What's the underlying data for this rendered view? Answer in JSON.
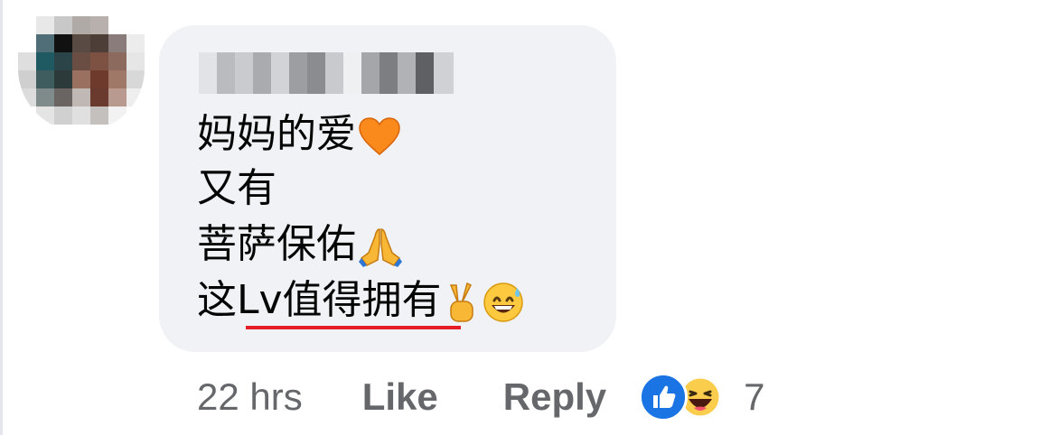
{
  "comment": {
    "author_name_label": "Comment author name (blurred)",
    "lines": [
      "妈妈的爱",
      "又有",
      "菩萨保佑",
      "这",
      "Lv值得拥有"
    ],
    "emoji": {
      "line1": "orange-heart",
      "line3": "folded-hands",
      "line4": [
        "victory-hand",
        "grinning-sweat-face"
      ]
    },
    "highlight_color": "#e41e26"
  },
  "actions": {
    "time": "22 hrs",
    "like_label": "Like",
    "reply_label": "Reply",
    "reaction_count": "7",
    "reactions": [
      "like",
      "haha"
    ],
    "like_color": "#1b74e4"
  }
}
